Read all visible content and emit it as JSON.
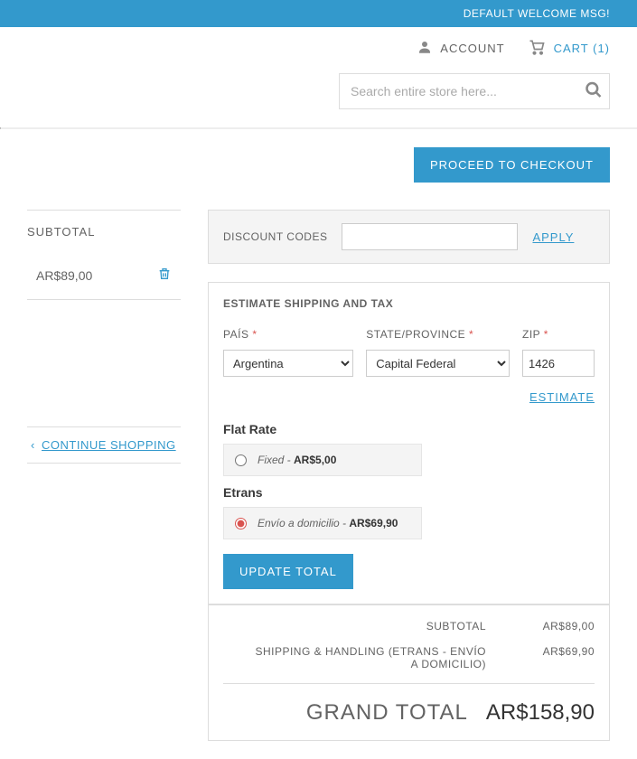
{
  "topbar": {
    "welcome": "DEFAULT WELCOME MSG!"
  },
  "header": {
    "account_label": "ACCOUNT",
    "cart_label": "CART (1)",
    "search_placeholder": "Search entire store here..."
  },
  "actions": {
    "proceed_checkout": "PROCEED TO CHECKOUT",
    "continue_shopping": "CONTINUE SHOPPING",
    "apply": "APPLY",
    "estimate": "ESTIMATE",
    "update_total": "UPDATE TOTAL"
  },
  "sidebar": {
    "subtotal_label": "SUBTOTAL",
    "subtotal_value": "AR$89,00"
  },
  "discount": {
    "label": "DISCOUNT CODES",
    "value": ""
  },
  "shipping": {
    "heading": "ESTIMATE SHIPPING AND TAX",
    "country_label": "PAÍS",
    "country_value": "Argentina",
    "state_label": "STATE/PROVINCE",
    "state_value": "Capital Federal",
    "zip_label": "ZIP",
    "zip_value": "1426",
    "methods": {
      "flat_rate": {
        "title": "Flat Rate",
        "option_label": "Fixed",
        "option_price": "AR$5,00"
      },
      "etrans": {
        "title": "Etrans",
        "option_label": "Envío a domicilio",
        "option_price": "AR$69,90"
      }
    }
  },
  "totals": {
    "subtotal_label": "SUBTOTAL",
    "subtotal_value": "AR$89,00",
    "shipping_label": "SHIPPING & HANDLING (ETRANS - ENVÍO A DOMICILIO)",
    "shipping_value": "AR$69,90",
    "grand_label": "GRAND TOTAL",
    "grand_value": "AR$158,90"
  }
}
